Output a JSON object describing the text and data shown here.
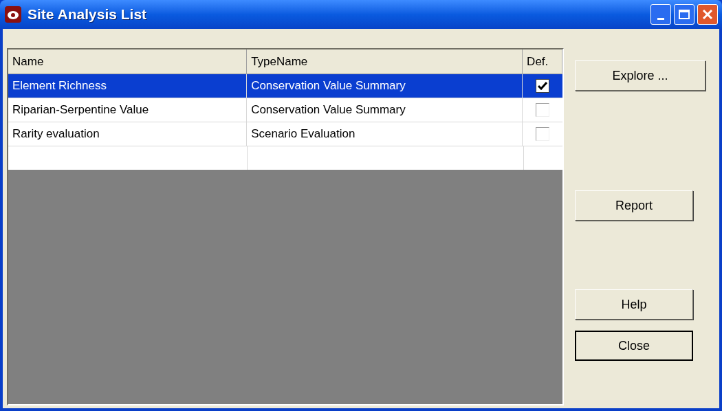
{
  "window": {
    "title": "Site Analysis List"
  },
  "table": {
    "columns": [
      "Name",
      "TypeName",
      "Def."
    ],
    "rows": [
      {
        "name": "Element Richness",
        "type_name": "Conservation Value Summary",
        "default": true,
        "selected": true
      },
      {
        "name": "Riparian-Serpentine Value",
        "type_name": "Conservation Value Summary",
        "default": false,
        "selected": false
      },
      {
        "name": "Rarity evaluation",
        "type_name": "Scenario Evaluation",
        "default": false,
        "selected": false
      }
    ]
  },
  "buttons": [
    {
      "label": "Explore ...",
      "kind": "wide",
      "default": false
    },
    {
      "label": "Report",
      "kind": "normal",
      "default": false
    },
    {
      "label": "Help",
      "kind": "normal",
      "default": false
    },
    {
      "label": "Close",
      "kind": "normal",
      "default": true
    }
  ]
}
